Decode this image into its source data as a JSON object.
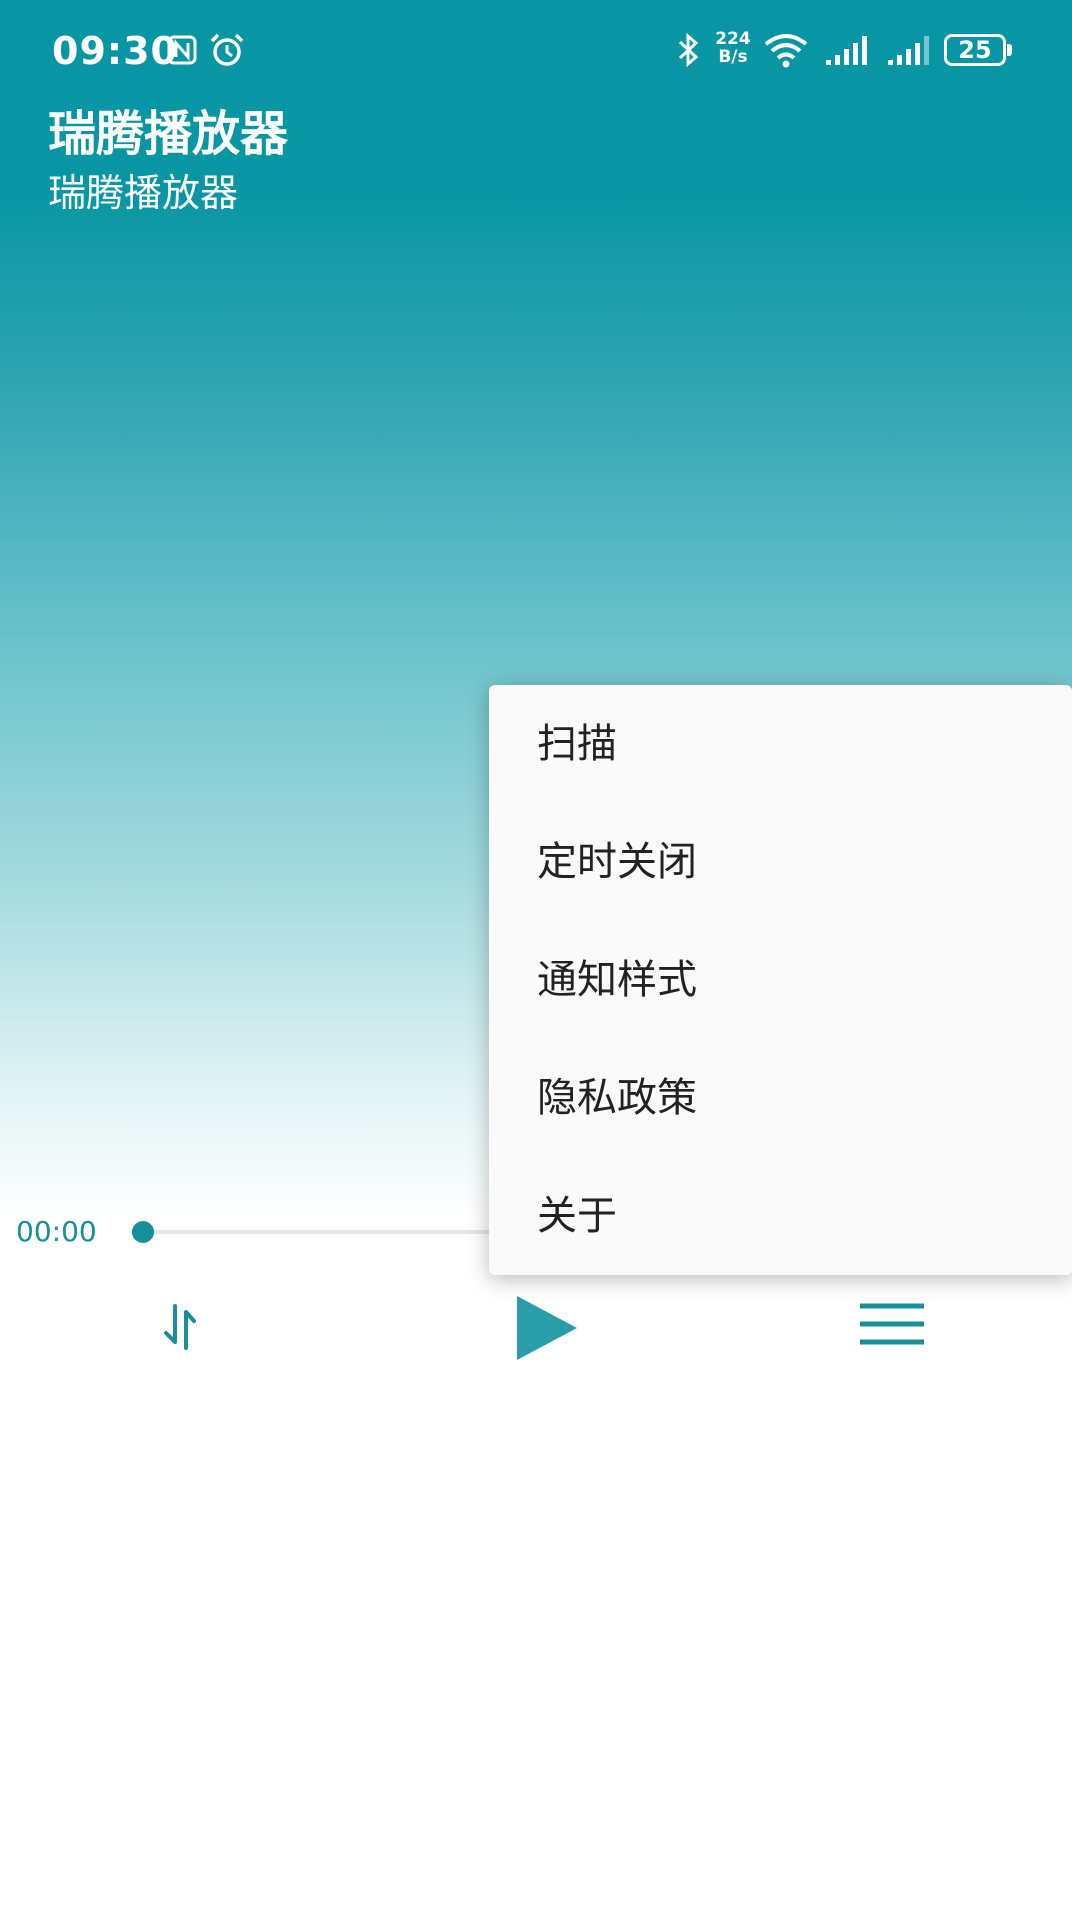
{
  "status_bar": {
    "time": "09:30",
    "net_speed_value": "224",
    "net_speed_unit": "B/s",
    "battery_level": "25",
    "icons": [
      "nfc-icon",
      "alarm-icon",
      "bluetooth-icon",
      "wifi-icon",
      "signal-icon",
      "signal-icon",
      "battery-icon"
    ]
  },
  "header": {
    "title": "瑞腾播放器",
    "subtitle": "瑞腾播放器"
  },
  "player": {
    "current_time": "00:00",
    "progress": 0,
    "controls": [
      "shuffle-icon",
      "play-icon",
      "menu-icon"
    ]
  },
  "menu": {
    "items": [
      {
        "label": "扫描"
      },
      {
        "label": "定时关闭"
      },
      {
        "label": "通知样式"
      },
      {
        "label": "隐私政策"
      },
      {
        "label": "关于"
      }
    ]
  },
  "colors": {
    "accent": "#17909c",
    "header_bg": "#0896a4",
    "menu_bg": "#fafafa"
  }
}
